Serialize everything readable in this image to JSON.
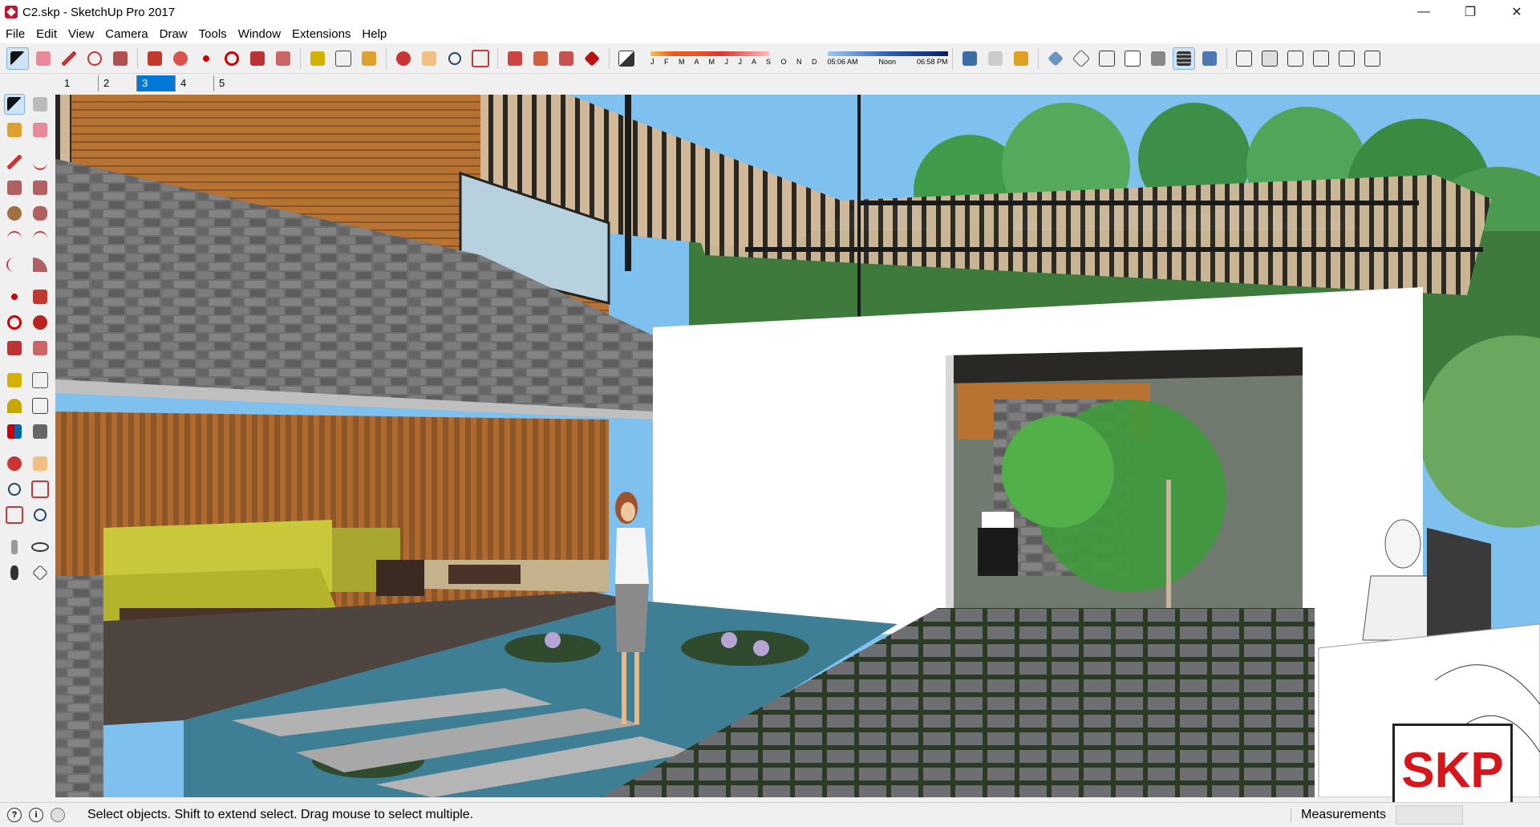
{
  "window": {
    "title": "C2.skp - SketchUp Pro 2017",
    "controls": [
      "—",
      "❐",
      "✕"
    ]
  },
  "menu": [
    "File",
    "Edit",
    "View",
    "Camera",
    "Draw",
    "Tools",
    "Window",
    "Extensions",
    "Help"
  ],
  "shadows": {
    "months": "J F M A M J J A S O N D",
    "time_start": "05:06 AM",
    "time_mid": "Noon",
    "time_end": "06:58 PM"
  },
  "scenes": [
    "1",
    "2",
    "3",
    "4",
    "5"
  ],
  "active_scene": "3",
  "status": {
    "message": "Select objects. Shift to extend select. Drag mouse to select multiple.",
    "measurements_label": "Measurements"
  },
  "logo_text": "SKP",
  "colors": {
    "accent": "#0078d7",
    "sky": "#7ec0ee",
    "wall_stone": "#6f6f6f",
    "wood": "#a8652c",
    "sofa": "#c8c83a",
    "water": "#3e7f95"
  }
}
